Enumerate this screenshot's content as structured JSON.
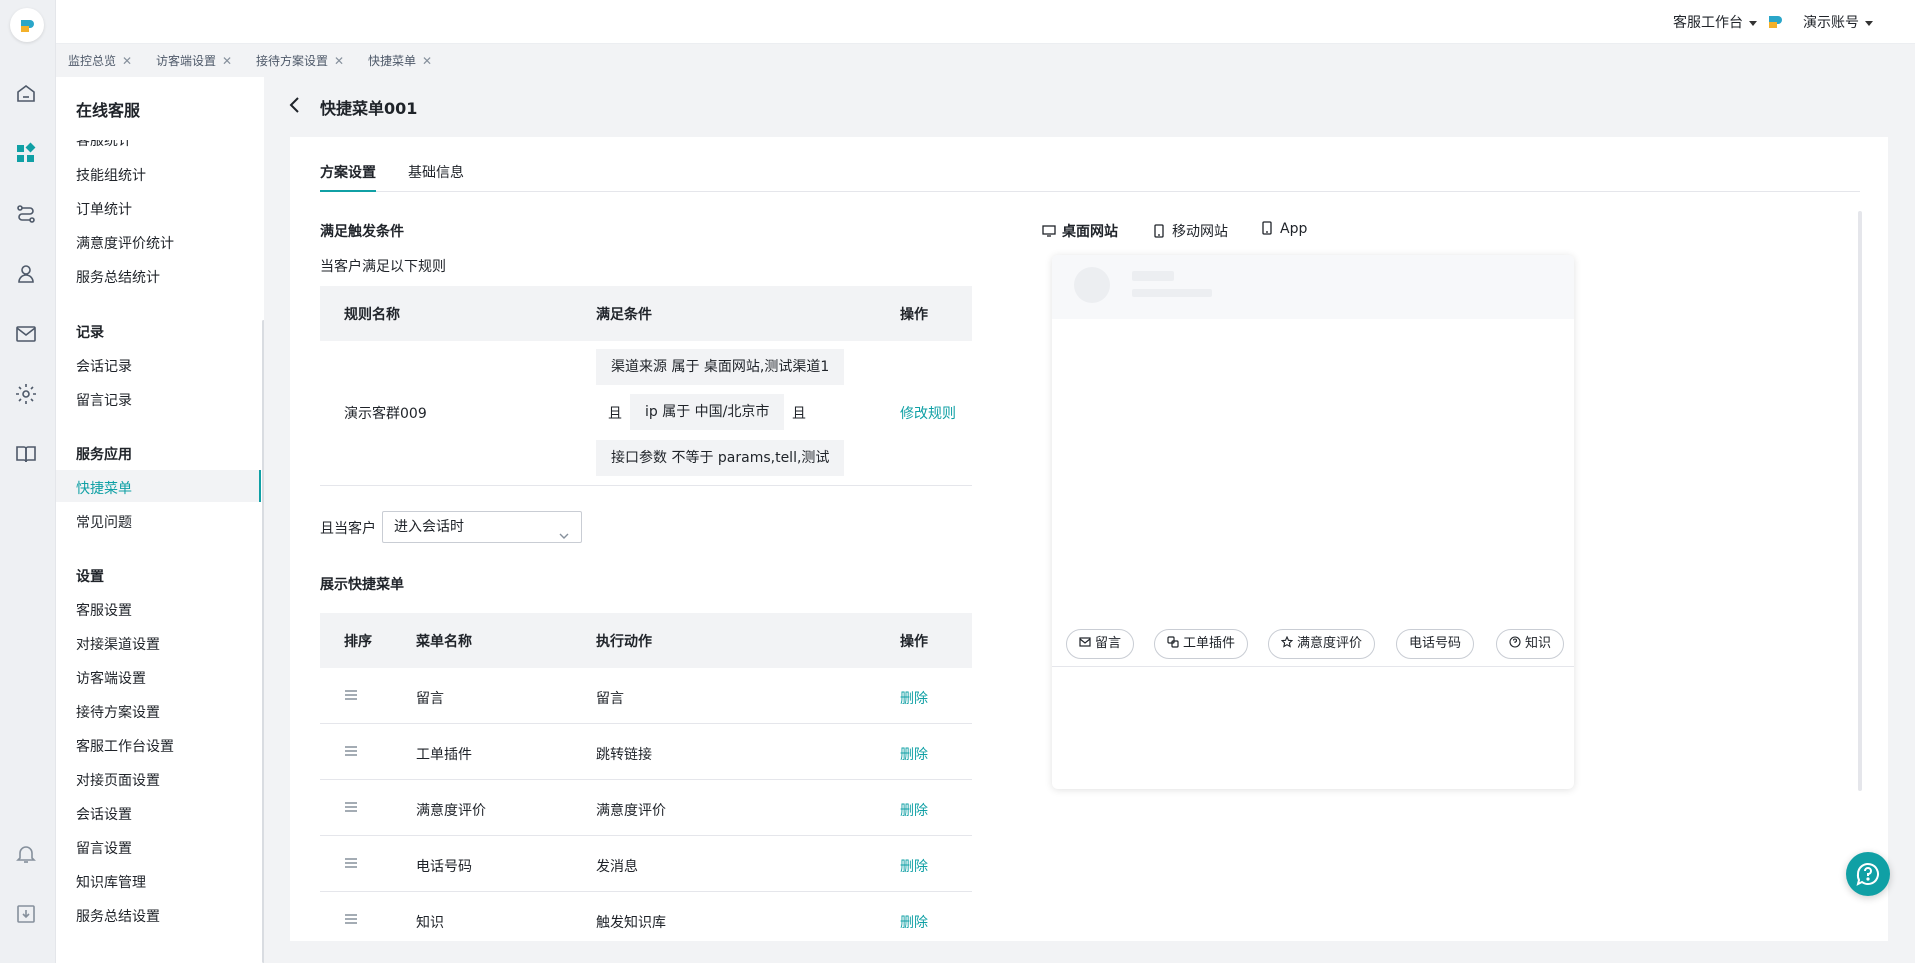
{
  "topbar": {
    "workspace_label": "客服工作台",
    "account_label": "演示账号"
  },
  "tabs": [
    {
      "label": "监控总览"
    },
    {
      "label": "访客端设置"
    },
    {
      "label": "接待方案设置"
    },
    {
      "label": "快捷菜单"
    }
  ],
  "sidebar": {
    "title": "在线客服",
    "items_top": [
      "客服统计",
      "技能组统计",
      "订单统计",
      "满意度评价统计",
      "服务总结统计"
    ],
    "group_records": "记录",
    "items_records": [
      "会话记录",
      "留言记录"
    ],
    "group_apps": "服务应用",
    "items_apps": [
      "快捷菜单",
      "常见问题"
    ],
    "group_settings": "设置",
    "items_settings": [
      "客服设置",
      "对接渠道设置",
      "访客端设置",
      "接待方案设置",
      "客服工作台设置",
      "对接页面设置",
      "会话设置",
      "留言设置",
      "知识库管理",
      "服务总结设置"
    ]
  },
  "page": {
    "title": "快捷菜单001",
    "tab_plan": "方案设置",
    "tab_basic": "基础信息"
  },
  "trigger": {
    "section_title": "满足触发条件",
    "subtitle": "当客户满足以下规则",
    "headers": [
      "规则名称",
      "满足条件",
      "操作"
    ],
    "rule_name": "演示客群009",
    "cond1": "渠道来源 属于 桌面网站,测试渠道1",
    "and": "且",
    "cond2": "ip 属于 中国/北京市",
    "cond3": "接口参数 不等于 params,tell,测试",
    "edit": "修改规则",
    "when_label": "且当客户",
    "when_value": "进入会话时"
  },
  "menu": {
    "section_title": "展示快捷菜单",
    "headers": [
      "排序",
      "菜单名称",
      "执行动作",
      "操作"
    ],
    "rows": [
      {
        "name": "留言",
        "action": "留言",
        "op": "删除"
      },
      {
        "name": "工单插件",
        "action": "跳转链接",
        "op": "删除"
      },
      {
        "name": "满意度评价",
        "action": "满意度评价",
        "op": "删除"
      },
      {
        "name": "电话号码",
        "action": "发消息",
        "op": "删除"
      },
      {
        "name": "知识",
        "action": "触发知识库",
        "op": "删除"
      }
    ]
  },
  "preview": {
    "devices": [
      "桌面网站",
      "移动网站",
      "App"
    ],
    "chips": [
      "留言",
      "工单插件",
      "满意度评价",
      "电话号码",
      "知识"
    ]
  },
  "colors": {
    "accent": "#10a0a5",
    "background": "#f2f3f5"
  },
  "icons": [
    "home-icon",
    "grid-icon",
    "route-icon",
    "user-icon",
    "mail-icon",
    "gear-icon",
    "book-icon",
    "bell-icon",
    "download-icon",
    "help-icon"
  ]
}
